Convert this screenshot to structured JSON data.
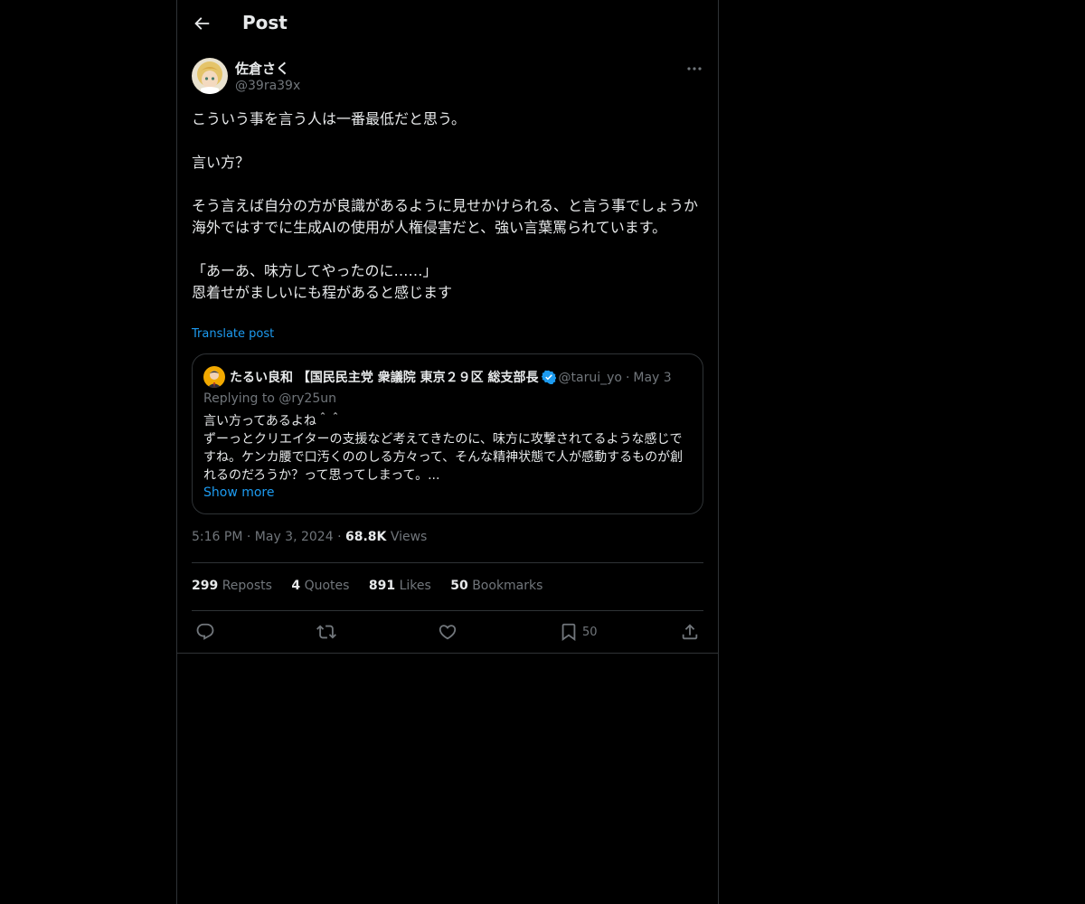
{
  "header": {
    "title": "Post",
    "back_icon": "arrow-left-icon"
  },
  "author": {
    "name": "佐倉さく",
    "handle": "@39ra39x"
  },
  "post": {
    "text": "こういう事を言う人は一番最低だと思う。\n\n言い方？\n\nそう言えば自分の方が良識があるように見せかけられる、と言う事でしょうか\n海外ではすでに生成AIの使用が人権侵害だと、強い言葉罵られています。\n\n「あーあ、味方してやったのに……」\n恩着せがましいにも程があると感じます",
    "translate_label": "Translate post"
  },
  "quote": {
    "name": "たるい良和 【国民民主党 衆議院 東京２９区 総支部長",
    "handle": "@tarui_yo",
    "separator": "·",
    "date": "May 3",
    "replying_to": "Replying to @ry25un",
    "text": "言い方ってあるよね＾＾\nずーっとクリエイターの支援など考えてきたのに、味方に攻撃されてるような感じですね。ケンカ腰で口汚くののしる方々って、そんな精神状態で人が感動するものが創れるのだろうか？って思ってしまって。...",
    "show_more": "Show more"
  },
  "meta": {
    "time": "5:16 PM",
    "date": "May 3, 2024",
    "separator": "·",
    "views_count": "68.8K",
    "views_label": "Views"
  },
  "stats": [
    {
      "count": "299",
      "label": "Reposts"
    },
    {
      "count": "4",
      "label": "Quotes"
    },
    {
      "count": "891",
      "label": "Likes"
    },
    {
      "count": "50",
      "label": "Bookmarks"
    }
  ],
  "actions": {
    "bookmark_count": "50"
  },
  "colors": {
    "background": "#000000",
    "border": "#2f3336",
    "text": "#e7e9ea",
    "muted": "#71767b",
    "accent": "#1d9bf0"
  }
}
